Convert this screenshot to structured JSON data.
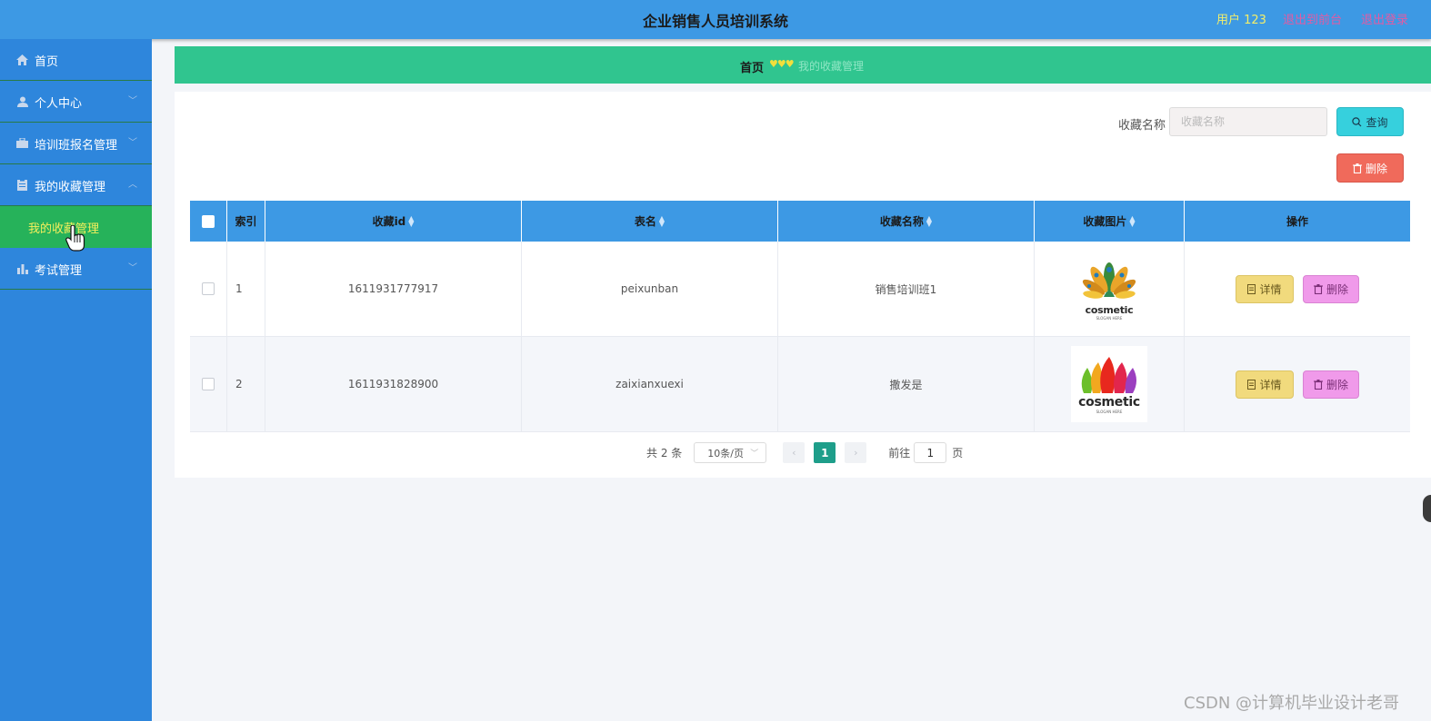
{
  "header": {
    "title": "企业销售人员培训系统",
    "user": "用户 123",
    "back_front": "退出到前台",
    "logout": "退出登录"
  },
  "sidebar": {
    "items": [
      {
        "label": "首页",
        "icon": "home-icon"
      },
      {
        "label": "个人中心",
        "icon": "user-icon"
      },
      {
        "label": "培训班报名管理",
        "icon": "briefcase-icon"
      },
      {
        "label": "我的收藏管理",
        "icon": "clipboard-icon"
      },
      {
        "label": "考试管理",
        "icon": "bar-chart-icon"
      }
    ],
    "submenu_active": "我的收藏管理"
  },
  "breadcrumb": {
    "home": "首页",
    "current": "我的收藏管理"
  },
  "search": {
    "label": "收藏名称",
    "placeholder": "收藏名称",
    "query_button": "查询",
    "delete_button": "删除"
  },
  "table": {
    "headers": [
      "索引",
      "收藏id",
      "表名",
      "收藏名称",
      "收藏图片",
      "操作"
    ],
    "rows": [
      {
        "index": "1",
        "id": "1611931777917",
        "table_name": "peixunban",
        "name": "销售培训班1",
        "logo_text": "cosmetic",
        "logo_sub": "SLOGAN HERE"
      },
      {
        "index": "2",
        "id": "1611931828900",
        "table_name": "zaixianxuexi",
        "name": "撒发是",
        "logo_text": "cosmetic",
        "logo_sub": "SLOGAN HERE"
      }
    ],
    "detail_button": "详情",
    "delete_button": "删除"
  },
  "pagination": {
    "total": "共 2 条",
    "page_size": "10条/页",
    "current_page": "1",
    "goto_label": "前往",
    "goto_value": "1",
    "page_suffix": "页"
  },
  "watermark": "CSDN @计算机毕业设计老哥",
  "colors": {
    "header_bg": "#3d99e4",
    "sidebar_bg": "#2e86dc",
    "active_submenu_bg": "#26b25a",
    "breadcrumb_bg": "#30c58f",
    "query_button": "#36d0dd",
    "delete_button": "#f06a5b",
    "detail_button": "#f1da7d",
    "row_delete_button": "#f09aea"
  }
}
